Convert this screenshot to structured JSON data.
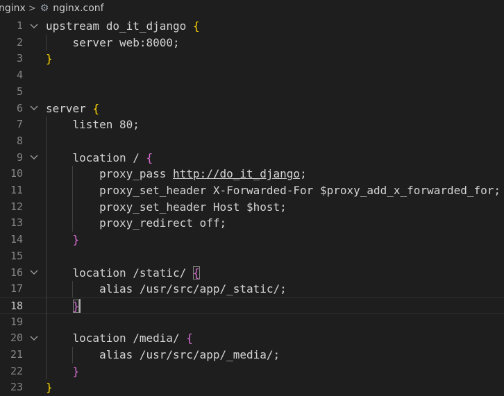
{
  "breadcrumb": {
    "folder": "nginx",
    "separator": ">",
    "file_icon": "gear-icon",
    "file": "nginx.conf"
  },
  "editor": {
    "current_line": 18,
    "lines": [
      {
        "n": "1",
        "fold": true,
        "tokens": [
          {
            "t": "upstream do_it_django ",
            "c": "plain"
          },
          {
            "t": "{",
            "c": "brace1"
          }
        ]
      },
      {
        "n": "2",
        "fold": false,
        "tokens": [
          {
            "t": "    server web:8000;",
            "c": "plain"
          }
        ]
      },
      {
        "n": "3",
        "fold": false,
        "tokens": [
          {
            "t": "}",
            "c": "brace1"
          }
        ]
      },
      {
        "n": "4",
        "fold": false,
        "tokens": []
      },
      {
        "n": "5",
        "fold": false,
        "tokens": []
      },
      {
        "n": "6",
        "fold": true,
        "tokens": [
          {
            "t": "server ",
            "c": "plain"
          },
          {
            "t": "{",
            "c": "brace1"
          }
        ]
      },
      {
        "n": "7",
        "fold": false,
        "tokens": [
          {
            "t": "    listen 80;",
            "c": "plain"
          }
        ]
      },
      {
        "n": "8",
        "fold": false,
        "tokens": []
      },
      {
        "n": "9",
        "fold": true,
        "tokens": [
          {
            "t": "    location / ",
            "c": "plain"
          },
          {
            "t": "{",
            "c": "brace2"
          }
        ]
      },
      {
        "n": "10",
        "fold": false,
        "tokens": [
          {
            "t": "        proxy_pass ",
            "c": "plain"
          },
          {
            "t": "http://do_it_django",
            "c": "url"
          },
          {
            "t": ";",
            "c": "plain"
          }
        ]
      },
      {
        "n": "11",
        "fold": false,
        "tokens": [
          {
            "t": "        proxy_set_header X-Forwarded-For $proxy_add_x_forwarded_for;",
            "c": "plain"
          }
        ]
      },
      {
        "n": "12",
        "fold": false,
        "tokens": [
          {
            "t": "        proxy_set_header Host $host;",
            "c": "plain"
          }
        ]
      },
      {
        "n": "13",
        "fold": false,
        "tokens": [
          {
            "t": "        proxy_redirect off;",
            "c": "plain"
          }
        ]
      },
      {
        "n": "14",
        "fold": false,
        "tokens": [
          {
            "t": "    ",
            "c": "plain"
          },
          {
            "t": "}",
            "c": "brace2"
          }
        ]
      },
      {
        "n": "15",
        "fold": false,
        "tokens": []
      },
      {
        "n": "16",
        "fold": true,
        "tokens": [
          {
            "t": "    location /static/ ",
            "c": "plain"
          },
          {
            "t": "{",
            "c": "brace2 bmatch"
          }
        ]
      },
      {
        "n": "17",
        "fold": false,
        "tokens": [
          {
            "t": "        alias /usr/src/app/_static/;",
            "c": "plain"
          }
        ]
      },
      {
        "n": "18",
        "fold": false,
        "tokens": [
          {
            "t": "    ",
            "c": "plain"
          },
          {
            "t": "}",
            "c": "brace2 bmatch"
          }
        ]
      },
      {
        "n": "19",
        "fold": false,
        "tokens": []
      },
      {
        "n": "20",
        "fold": true,
        "tokens": [
          {
            "t": "    location /media/ ",
            "c": "plain"
          },
          {
            "t": "{",
            "c": "brace2"
          }
        ]
      },
      {
        "n": "21",
        "fold": false,
        "tokens": [
          {
            "t": "        alias /usr/src/app/_media/;",
            "c": "plain"
          }
        ]
      },
      {
        "n": "22",
        "fold": false,
        "tokens": [
          {
            "t": "    ",
            "c": "plain"
          },
          {
            "t": "}",
            "c": "brace2"
          }
        ]
      },
      {
        "n": "23",
        "fold": false,
        "tokens": [
          {
            "t": "}",
            "c": "brace1"
          }
        ]
      }
    ]
  }
}
